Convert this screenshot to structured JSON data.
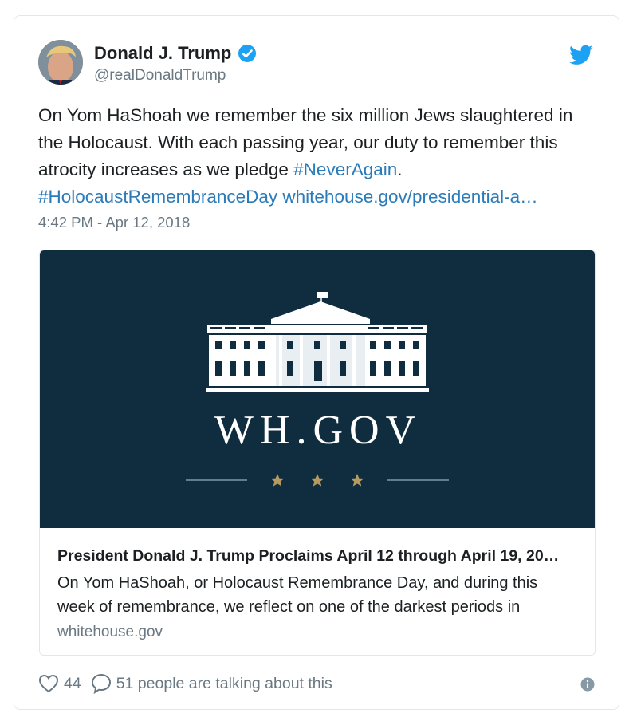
{
  "author": {
    "display_name": "Donald J. Trump",
    "handle": "@realDonaldTrump",
    "verified": true,
    "avatar_icon": "profile-photo",
    "verified_color": "#1da1f2"
  },
  "tweet": {
    "text_plain_1": "On Yom HaShoah we remember the six million Jews slaughtered in the Holocaust. With each passing year, our duty to remember this atrocity increases as we pledge ",
    "hashtag_1": "#NeverAgain",
    "text_plain_2": ".",
    "hashtag_2": "#HolocaustRemembranceDay",
    "link": "whitehouse.gov/presidential-a…",
    "timestamp": "4:42 PM - Apr 12, 2018",
    "link_color": "#2b7bb9"
  },
  "card": {
    "image_text": "WH.GOV",
    "image_bg": "#0f2d3f",
    "title": "President Donald J. Trump Proclaims April 12 through April 19, 20…",
    "description": "On Yom HaShoah, or Holocaust Remembrance Day, and during this week of remembrance, we reflect on one of the darkest periods in",
    "domain": "whitehouse.gov"
  },
  "actions": {
    "likes": "44",
    "talking": "51 people are talking about this"
  },
  "icons": {
    "brand": "twitter-bird-icon",
    "like": "heart-icon",
    "reply": "speech-bubble-icon",
    "info": "info-icon"
  },
  "brand_color": "#1da1f2"
}
